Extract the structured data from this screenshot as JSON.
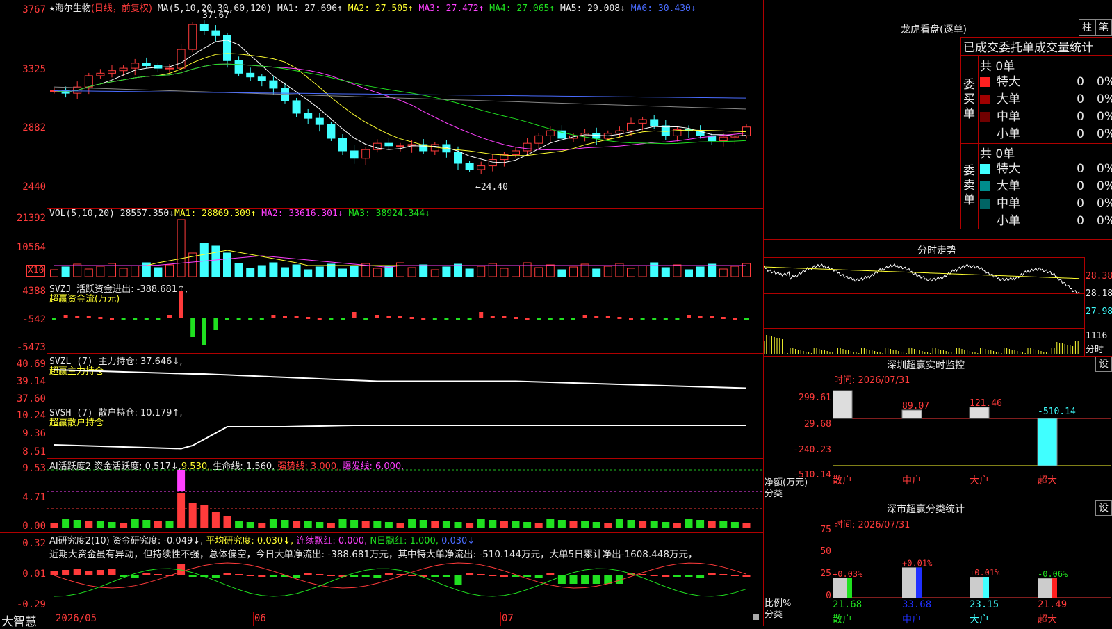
{
  "colors": {
    "up": "#ff3b3b",
    "down": "#40ffff",
    "grid": "#b00000",
    "ma1": "#ffffff",
    "ma2": "#ffff30",
    "ma3": "#ff40ff",
    "ma4": "#20e020",
    "ma5": "#888888",
    "ma6": "#4a6cff"
  },
  "main": {
    "star": "★",
    "stock_name": "海尔生物",
    "mode": "(日线，前复权)",
    "ma_label": "MA(5,10,20,30,60,120)",
    "ma1": "MA1: 27.696↑",
    "ma2": "MA2: 27.505↑",
    "ma3": "MA3: 27.472↑",
    "ma4": "MA4: 27.065↑",
    "ma5": "MA5: 29.008↓",
    "ma6": "MA6: 30.430↓",
    "high_label": "37.67",
    "low_label": "←24.40",
    "axis": [
      "3767",
      "3325",
      "2882",
      "2440"
    ]
  },
  "vol": {
    "label": "VOL(5,10,20)",
    "value": "28557.350↓",
    "ma1": "MA1: 28869.309↑",
    "ma2": "MA2: 33616.301↓",
    "ma3": "MA3: 38924.344↓",
    "axis": [
      "21392",
      "10564"
    ],
    "unit": "X10"
  },
  "svzj": {
    "label": "SVZJ",
    "title": "活跃资金进出: -388.681↑,",
    "sub": "超赢资金流(万元)",
    "axis": [
      "4388",
      "-542",
      "-5473"
    ]
  },
  "svzl": {
    "label": "SVZL (7)",
    "title": "主力持仓: 37.646↓,",
    "sub": "超赢主力持仓",
    "axis": [
      "40.69",
      "39.14",
      "37.60"
    ]
  },
  "svsh": {
    "label": "SVSH (7)",
    "title": "散户持仓: 10.179↑,",
    "sub": "超赢散户持仓",
    "axis": [
      "10.24",
      "9.36",
      "8.51"
    ]
  },
  "ai1": {
    "label": "AI活跃度2",
    "t1": "资金活跃度: 0.517↓,",
    "t2": "9.530,",
    "t3": "生命线: 1.560,",
    "t4": "强势线: 3.000,",
    "t5": "爆发线: 6.000,",
    "axis": [
      "9.53",
      "4.71",
      "0.00"
    ]
  },
  "ai2": {
    "label": "AI研究度2(10)",
    "t1": "资金研究度: -0.049↓,",
    "t2": "平均研究度: 0.030↓,",
    "t3": "连续飘红: 0.000,",
    "t4": "N日飘红: 1.000,",
    "t5": "0.030↓",
    "note": "近期大资金虽有异动，但持续性不强，总体偏空，今日大单净流出: -388.681万元，其中特大单净流出: -510.144万元，大单5日累计净出-1608.448万元，",
    "axis": [
      "0.32",
      "0.01",
      "-0.29"
    ]
  },
  "bottom": {
    "brand": "大智慧",
    "dates": [
      "2026/05",
      "06",
      "07"
    ]
  },
  "dragon": {
    "title": "龙虎看盘(逐单)",
    "btn1": "柱",
    "btn2": "笔",
    "header": "已成交委托单成交量统计",
    "buy_side": "委买单",
    "sell_side": "委卖单",
    "buy_total": "共 0单",
    "sell_total": "共 0单",
    "buy_rows": [
      {
        "label": "特大",
        "n": "0",
        "p": "0%",
        "color": "#ff2020"
      },
      {
        "label": "大单",
        "n": "0",
        "p": "0%",
        "color": "#a00000"
      },
      {
        "label": "中单",
        "n": "0",
        "p": "0%",
        "color": "#700000"
      },
      {
        "label": "小单",
        "n": "0",
        "p": "0%",
        "color": "#000000"
      }
    ],
    "sell_rows": [
      {
        "label": "特大",
        "n": "0",
        "p": "0%",
        "color": "#40ffff"
      },
      {
        "label": "大单",
        "n": "0",
        "p": "0%",
        "color": "#008c8c"
      },
      {
        "label": "中单",
        "n": "0",
        "p": "0%",
        "color": "#006464"
      },
      {
        "label": "小单",
        "n": "0",
        "p": "0%",
        "color": "#000000"
      }
    ]
  },
  "intraday": {
    "title": "分时走势",
    "axis": [
      "28.38",
      "28.18",
      "27.98"
    ],
    "vol": "1116",
    "unit": "分时"
  },
  "monitor": {
    "title": "深圳超赢实时监控",
    "btn": "设",
    "time": "时间: 2026/07/31",
    "axis": [
      "299.61",
      "29.68",
      "-240.23",
      "-510.14"
    ],
    "unit_a": "净额(万元)",
    "unit_b": "分类",
    "bars": [
      {
        "label": "散户",
        "value": "299.61"
      },
      {
        "label": "中户",
        "value": "89.07"
      },
      {
        "label": "大户",
        "value": "121.46"
      },
      {
        "label": "超大",
        "value": "-510.14"
      }
    ]
  },
  "classify": {
    "title": "深市超赢分类统计",
    "btn": "设",
    "time": "时间: 2026/07/31",
    "axis": [
      "75",
      "50",
      "25",
      "0"
    ],
    "unit_a": "比例%",
    "unit_b": "分类",
    "bars": [
      {
        "label": "散户",
        "value": "21.68",
        "change": "+0.03%"
      },
      {
        "label": "中户",
        "value": "33.68",
        "change": "+0.01%"
      },
      {
        "label": "大户",
        "value": "23.15",
        "change": "+0.01%"
      },
      {
        "label": "超大",
        "value": "21.49",
        "change": "-0.06%"
      }
    ]
  }
}
